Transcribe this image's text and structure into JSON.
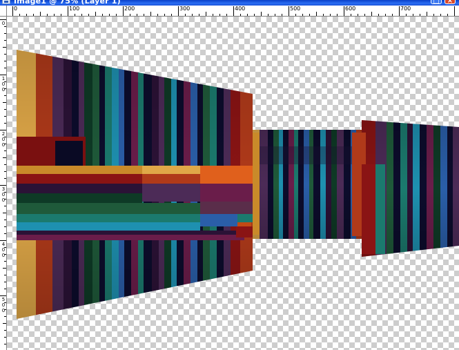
{
  "window": {
    "title": "Image1 @ 75% (Layer 1)"
  },
  "ruler": {
    "top_labels": [
      "0",
      "100",
      "200",
      "300",
      "400",
      "500",
      "600",
      "700"
    ],
    "left_labels": [
      "0",
      "100",
      "200",
      "300",
      "400",
      "500"
    ]
  },
  "colors": {
    "title_bar": "#1a52d9",
    "checker_light": "#ffffff",
    "checker_dark": "#cdcdcd",
    "close_button": "#d8492a"
  },
  "canvas": {
    "stripe_palette": [
      "#e0a848",
      "#b03a1a",
      "#8a1414",
      "#4c2b57",
      "#2b1236",
      "#0c0c2c",
      "#0e3a26",
      "#1f5a3a",
      "#1b7a6e",
      "#1e90b0",
      "#2a5ea8",
      "#6a1d4a",
      "#c24a14",
      "#e0601c"
    ]
  }
}
